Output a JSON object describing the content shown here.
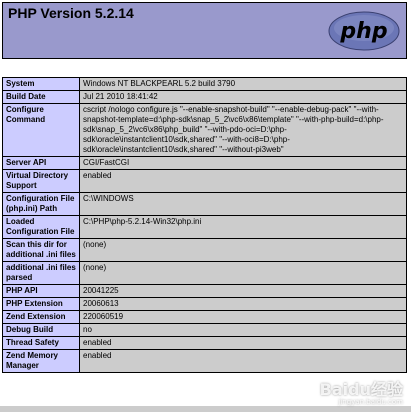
{
  "header": {
    "title": "PHP Version 5.2.14",
    "logo_text": "php",
    "bg_color": "#9999cc"
  },
  "info_rows": [
    {
      "key": "System",
      "value": "Windows NT BLACKPEARL 5.2 build 3790"
    },
    {
      "key": "Build Date",
      "value": "Jul 21 2010 18:41:42"
    },
    {
      "key": "Configure Command",
      "value": "cscript /nologo configure.js \"--enable-snapshot-build\" \"--enable-debug-pack\" \"--with-snapshot-template=d:\\php-sdk\\snap_5_2\\vc6\\x86\\template\" \"--with-php-build=d:\\php-sdk\\snap_5_2\\vc6\\x86\\php_build\" \"--with-pdo-oci=D:\\php-sdk\\oracle\\instantclient10\\sdk,shared\" \"--with-oci8=D:\\php-sdk\\oracle\\instantclient10\\sdk,shared\" \"--without-pi3web\""
    },
    {
      "key": "Server API",
      "value": "CGI/FastCGI"
    },
    {
      "key": "Virtual Directory Support",
      "value": "enabled"
    },
    {
      "key": "Configuration File (php.ini) Path",
      "value": "C:\\WINDOWS"
    },
    {
      "key": "Loaded Configuration File",
      "value": "C:\\PHP\\php-5.2.14-Win32\\php.ini"
    },
    {
      "key": "Scan this dir for additional .ini files",
      "value": "(none)"
    },
    {
      "key": "additional .ini files parsed",
      "value": "(none)"
    },
    {
      "key": "PHP API",
      "value": "20041225"
    },
    {
      "key": "PHP Extension",
      "value": "20060613"
    },
    {
      "key": "Zend Extension",
      "value": "220060519"
    },
    {
      "key": "Debug Build",
      "value": "no"
    },
    {
      "key": "Thread Safety",
      "value": "enabled"
    },
    {
      "key": "Zend Memory Manager",
      "value": "enabled"
    }
  ],
  "watermark": {
    "main": "Baidu经验",
    "sub": "jingyan.baidu.com"
  },
  "colors": {
    "key_cell": "#ccccff",
    "value_cell": "#cccccc"
  }
}
